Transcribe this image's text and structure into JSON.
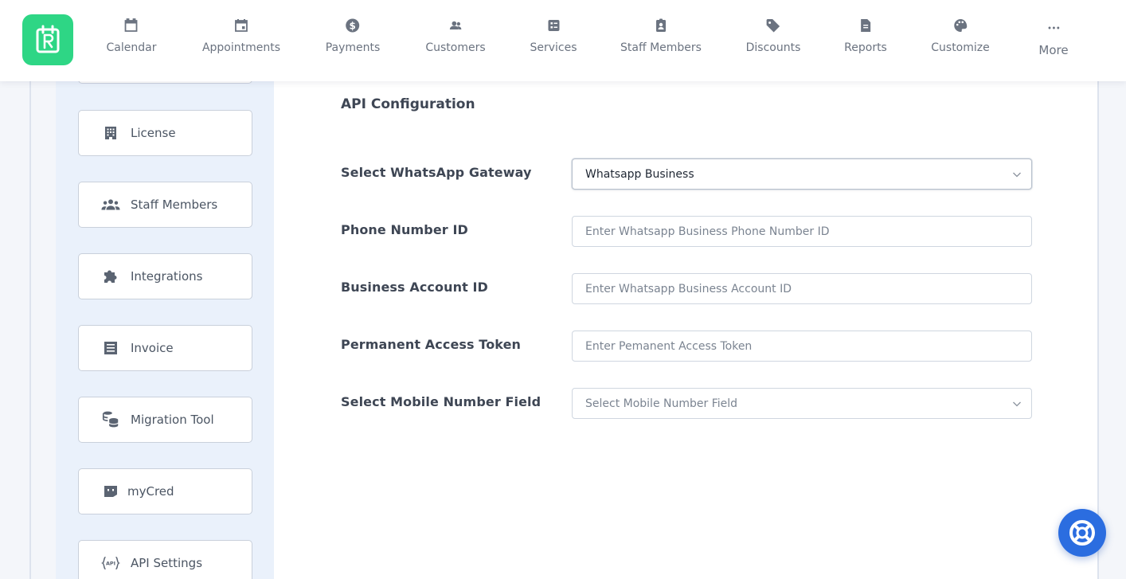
{
  "nav": {
    "items": [
      {
        "label": "Calendar",
        "icon": "calendar-icon"
      },
      {
        "label": "Appointments",
        "icon": "calendar-event-icon"
      },
      {
        "label": "Payments",
        "icon": "dollar-icon"
      },
      {
        "label": "Customers",
        "icon": "users-icon"
      },
      {
        "label": "Services",
        "icon": "list-icon"
      },
      {
        "label": "Staff Members",
        "icon": "badge-icon"
      },
      {
        "label": "Discounts",
        "icon": "tag-icon"
      },
      {
        "label": "Reports",
        "icon": "file-icon"
      },
      {
        "label": "Customize",
        "icon": "palette-icon"
      }
    ],
    "more_label": "More"
  },
  "sidebar": {
    "items": [
      {
        "label": "License",
        "icon": "building-icon"
      },
      {
        "label": "Staff Members",
        "icon": "users-icon"
      },
      {
        "label": "Integrations",
        "icon": "puzzle-icon"
      },
      {
        "label": "Invoice",
        "icon": "receipt-icon"
      },
      {
        "label": "Migration Tool",
        "icon": "database-icon"
      },
      {
        "label": "myCred",
        "icon": "mycred-icon"
      },
      {
        "label": "API Settings",
        "icon": "api-icon"
      }
    ]
  },
  "section": {
    "title": "API Configuration"
  },
  "form": {
    "gateway": {
      "label": "Select WhatsApp Gateway",
      "value": "Whatsapp Business"
    },
    "phone_id": {
      "label": "Phone Number ID",
      "placeholder": "Enter Whatsapp Business Phone Number ID"
    },
    "account_id": {
      "label": "Business Account ID",
      "placeholder": "Enter Whatsapp Business Account ID"
    },
    "token": {
      "label": "Permanent Access Token",
      "placeholder": "Enter Pemanent Access Token"
    },
    "mobile_field": {
      "label": "Select Mobile Number Field",
      "placeholder": "Select Mobile Number Field"
    }
  },
  "colors": {
    "brand": "#2ed685",
    "help": "#2b6de0"
  }
}
